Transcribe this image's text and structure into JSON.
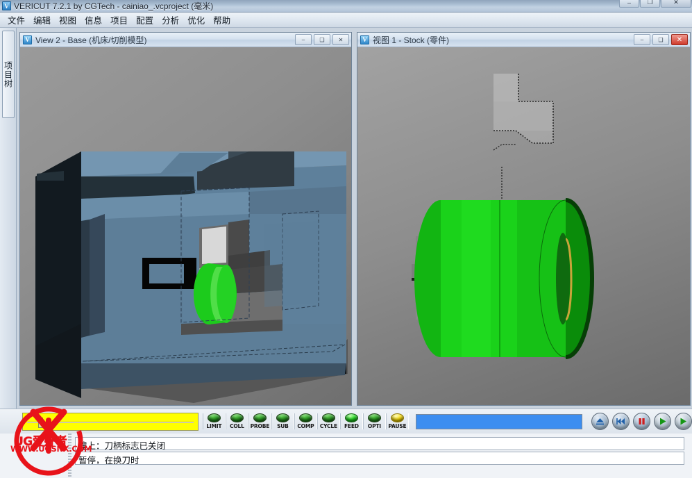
{
  "window": {
    "icon": "V",
    "title": "VERICUT 7.2.1 by CGTech - cainiao_.vcproject (毫米)",
    "buttons": [
      {
        "name": "minimize",
        "glyph": "–"
      },
      {
        "name": "maximize",
        "glyph": "❐"
      },
      {
        "name": "close",
        "glyph": "✕"
      }
    ]
  },
  "menubar": {
    "items": [
      {
        "label": "文件",
        "name": "file"
      },
      {
        "label": "编辑",
        "name": "edit"
      },
      {
        "label": "视图",
        "name": "view"
      },
      {
        "label": "信息",
        "name": "info"
      },
      {
        "label": "项目",
        "name": "project"
      },
      {
        "label": "配置",
        "name": "configure"
      },
      {
        "label": "分析",
        "name": "analysis"
      },
      {
        "label": "优化",
        "name": "optimize"
      },
      {
        "label": "帮助",
        "name": "help"
      }
    ]
  },
  "sidebar": {
    "tab_label": "项目树"
  },
  "panels": [
    {
      "name": "view-2-base",
      "icon": "V",
      "title": "View 2 - Base (机床/切削模型)",
      "buttons": [
        {
          "name": "minimize",
          "glyph": "–"
        },
        {
          "name": "restore",
          "glyph": "❑"
        },
        {
          "name": "close",
          "glyph": "✕"
        }
      ],
      "scene": "cnc-lathe-machine-model"
    },
    {
      "name": "view-1-stock",
      "icon": "V",
      "title": "视图 1 - Stock (零件)",
      "buttons": [
        {
          "name": "minimize",
          "glyph": "–"
        },
        {
          "name": "restore",
          "glyph": "❑"
        },
        {
          "name": "close",
          "glyph": "✕"
        }
      ],
      "scene": "green-cylindrical-stock-with-tool"
    }
  ],
  "bottombar": {
    "speed_slider": {
      "name": "simulation-speed-slider",
      "value_pct": 8,
      "color": "#ffff00"
    },
    "lamps": [
      {
        "label": "LIMIT",
        "state": "green"
      },
      {
        "label": "COLL",
        "state": "green"
      },
      {
        "label": "PROBE",
        "state": "green"
      },
      {
        "label": "SUB",
        "state": "green"
      },
      {
        "label": "COMP",
        "state": "green"
      },
      {
        "label": "CYCLE",
        "state": "green"
      },
      {
        "label": "FEED",
        "state": "bright"
      },
      {
        "label": "OPTI",
        "state": "green"
      },
      {
        "label": "PAUSE",
        "state": "yellow"
      }
    ],
    "progress": {
      "name": "nc-program-progress",
      "value_pct": 100,
      "color": "#3d8ef0"
    },
    "transport": [
      {
        "name": "reset-button",
        "icon": "eject-icon",
        "tone": "blue"
      },
      {
        "name": "rewind-button",
        "icon": "rewind-icon",
        "tone": "blue"
      },
      {
        "name": "pause-button",
        "icon": "pause-icon",
        "tone": "blue"
      },
      {
        "name": "play-button",
        "icon": "play-icon",
        "tone": "green"
      },
      {
        "name": "single-step-button",
        "icon": "play-step-icon",
        "tone": "green"
      }
    ]
  },
  "status": {
    "lines": [
      "撞上：刀柄标志已关闭",
      "暂停，在换刀时"
    ]
  },
  "watermark": {
    "line1": "UG爱好者",
    "line2": "WWW.UGSNX.COM",
    "color": "#e8131a"
  }
}
